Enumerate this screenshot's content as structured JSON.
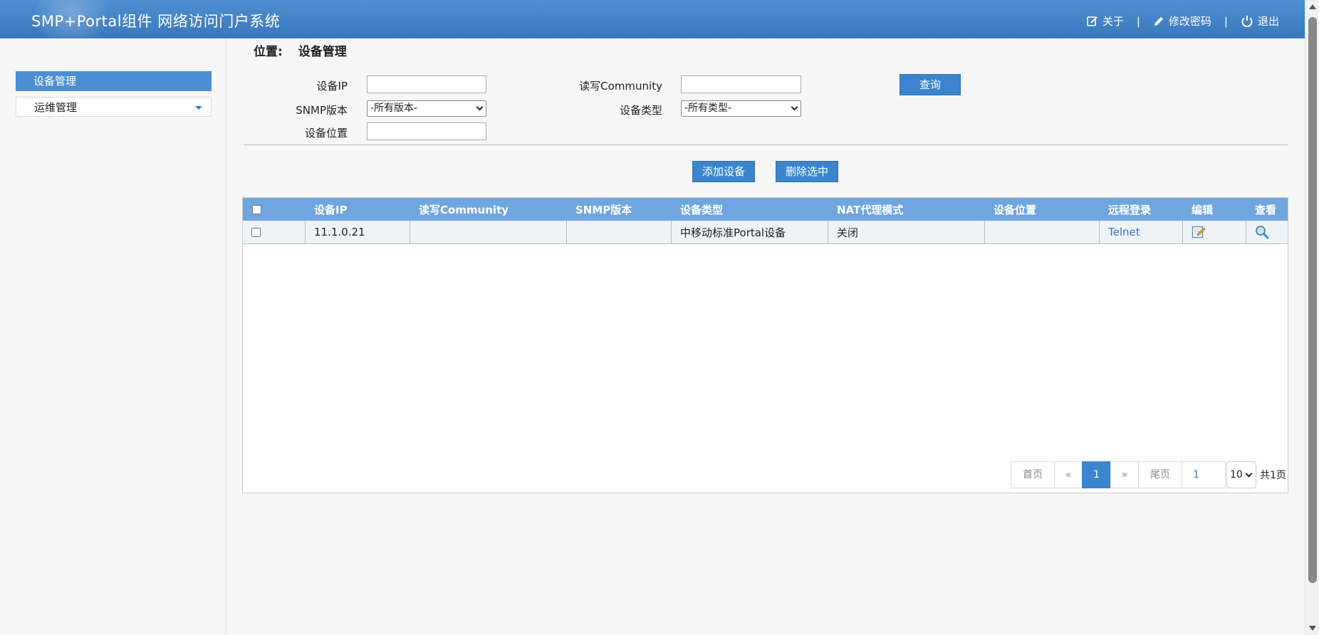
{
  "header": {
    "title": "SMP+Portal组件 网络访问门户系统",
    "about": "关于",
    "change_password": "修改密码",
    "logout": "退出",
    "separator": "|"
  },
  "sidebar": {
    "items": [
      {
        "label": "设备管理",
        "active": true
      },
      {
        "label": "运维管理",
        "active": false
      }
    ]
  },
  "breadcrumb": {
    "label": "位置:",
    "current": "设备管理"
  },
  "filters": {
    "device_ip_label": "设备IP",
    "device_ip_value": "",
    "community_label": "读写Community",
    "community_value": "",
    "snmp_label": "SNMP版本",
    "snmp_selected": "-所有版本-",
    "type_label": "设备类型",
    "type_selected": "-所有类型-",
    "location_label": "设备位置",
    "location_value": "",
    "query_button": "查询"
  },
  "actions": {
    "add": "添加设备",
    "delete": "删除选中"
  },
  "table": {
    "columns": [
      "设备IP",
      "读写Community",
      "SNMP版本",
      "设备类型",
      "NAT代理模式",
      "设备位置",
      "远程登录",
      "编辑",
      "查看"
    ],
    "rows": [
      {
        "ip": "11.1.0.21",
        "community": "",
        "snmp": "",
        "type": "中移动标准Portal设备",
        "nat": "关闭",
        "location": "",
        "remote": "Telnet"
      }
    ]
  },
  "pagination": {
    "first": "首页",
    "prev": "«",
    "current": "1",
    "next": "»",
    "last": "尾页",
    "page_input": "1",
    "page_size": "10",
    "total": "共1页"
  },
  "colors": {
    "header": "#3a78be",
    "accent": "#3b85cf",
    "table_head": "#6fa6e0"
  }
}
